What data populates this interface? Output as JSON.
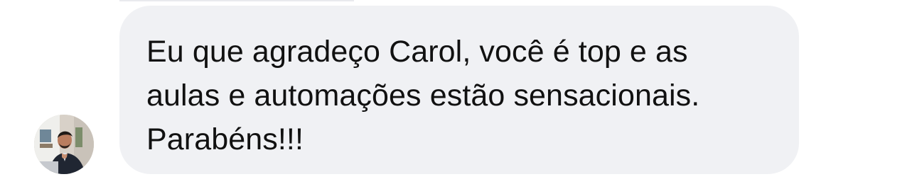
{
  "chat": {
    "message": {
      "text": "Eu que agradeço Carol, você é top e as\naulas e automações estão sensacionais.\nParabéns!!!"
    },
    "sender": {
      "avatar_icon": "person-avatar"
    },
    "colors": {
      "bubble": "#f0f1f4",
      "text": "#111111",
      "background": "#ffffff"
    }
  }
}
